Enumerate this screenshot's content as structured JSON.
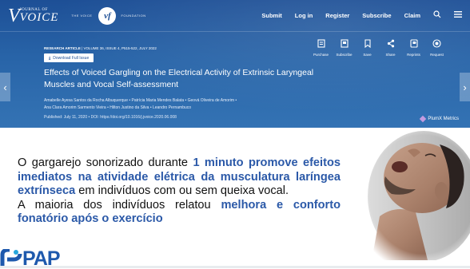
{
  "site": {
    "logo_journal": "JOURNAL OF",
    "logo_voice": "VOICE",
    "logo_official": "THE VOICE",
    "logo_badge": "vf",
    "logo_foundation": "FOUNDATION",
    "nav": [
      "Submit",
      "Log in",
      "Register",
      "Subscribe",
      "Claim"
    ]
  },
  "article": {
    "meta_type": "RESEARCH ARTICLE",
    "meta_volume": "| VOLUME 36, ISSUE 4, P515-522, JULY 2022",
    "download_label": "Download Full Issue",
    "title": "Effects of Voiced Gargling on the Electrical Activity of Extrinsic Laryngeal Muscles and Vocal Self-assessment",
    "authors_line1": "Amabelle Ayesa Santos da Rocha Albuquerque • Patrícia Maria Mendes Balata • Geová Oliveira de Amorim •",
    "authors_line2": "Ana Clara Amorim Sarmento Vieira • Hilton Justino da Silva • Leandro Pernambuco",
    "published": "Published: July 11, 2020 • DOI: https://doi.org/10.1016/j.jvoice.2020.06.008",
    "plumx": "PlumX Metrics",
    "actions": [
      "Purchase",
      "Subscribe",
      "Save",
      "Share",
      "Reprints",
      "Request"
    ]
  },
  "slide": {
    "p1_a": "O gargarejo sonorizado durante ",
    "p1_hl": "1 minuto promove efeitos imediatos na atividade elétrica da musculatura laríngea extrínseca",
    "p1_b": " em indivíduos com ou sem queixa vocal.",
    "p2_a": "A maioria dos indivíduos relatou ",
    "p2_hl": "melhora e conforto fonatório após o exercício"
  },
  "brand": {
    "text": "PAP"
  },
  "colors": {
    "banner": "#2864a8",
    "highlight": "#2b59a8",
    "brand_blue": "#1e59ad",
    "brand_cyan": "#26a6dc"
  },
  "icons": [
    "search-icon",
    "purchase-icon",
    "subscribe-icon",
    "save-icon",
    "share-icon",
    "reprints-icon",
    "request-icon",
    "chevron-left-icon",
    "chevron-right-icon",
    "download-icon"
  ]
}
